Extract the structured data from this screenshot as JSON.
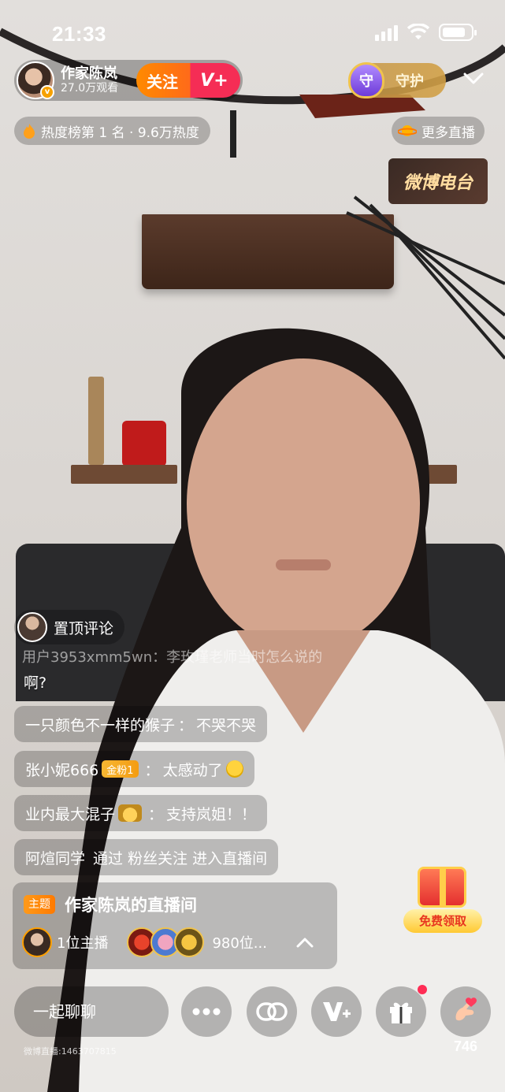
{
  "status_bar": {
    "time": "21:33"
  },
  "host": {
    "name": "作家陈岚",
    "viewers": "27.0万观看",
    "badge": "v",
    "follow_label": "关注",
    "vplus_label": "V+"
  },
  "guard": {
    "shield_glyph": "守",
    "label": "守护"
  },
  "hot_rank": {
    "text": "热度榜第 1 名 · 9.6万热度"
  },
  "more_live": {
    "label": "更多直播"
  },
  "radio_badge": {
    "label": "微博电台"
  },
  "comments": {
    "pinned_label": "置顶评论",
    "faded_line": "用户3953xmm5wn：李玫瑾老师当时怎么说的",
    "faded_tail": "啊?",
    "items": [
      {
        "user": "一只颜色不一样的猴子",
        "sep": "：",
        "msg": "不哭不哭"
      },
      {
        "user": "张小妮666",
        "badge": "金粉1",
        "sep": "：",
        "msg": "太感动了"
      },
      {
        "user": "业内最大混子",
        "sep": "：",
        "msg": "支持岚姐！！"
      },
      {
        "user": "阿煊同学",
        "msg": "通过 粉丝关注 进入直播间"
      }
    ]
  },
  "topic": {
    "tag": "主题",
    "title": "作家陈岚的直播间",
    "host_count": "1位主播",
    "fan_count": "980位..."
  },
  "gift_promo": {
    "label": "免费领取"
  },
  "bottom_bar": {
    "chat_placeholder": "一起聊聊",
    "like_count": "746",
    "room_id": "微博直播:1463707815"
  },
  "colors": {
    "follow_orange": "#ff7a00",
    "follow_pink": "#f52d55",
    "guard_gold": "#d4a04a",
    "topic_tag": "#ff8a00"
  },
  "icons": {
    "more": "more-dots-icon",
    "link": "link-icon",
    "vplus": "vplus-icon",
    "gift": "gift-icon",
    "like": "finger-heart-icon"
  }
}
